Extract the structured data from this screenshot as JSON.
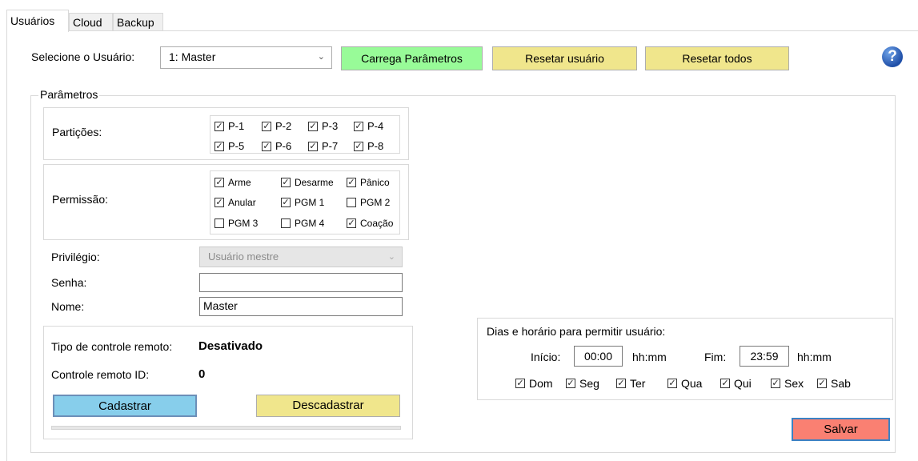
{
  "tabs": [
    "Usuários",
    "Cloud",
    "Backup"
  ],
  "header": {
    "select_user_label": "Selecione o Usuário:",
    "selected_user": "1: Master",
    "load_params_button": "Carrega Parâmetros",
    "reset_user_button": "Resetar usuário",
    "reset_all_button": "Resetar todos",
    "help_icon": "?"
  },
  "params": {
    "group_title": "Parâmetros",
    "partitions_label": "Partições:",
    "partitions": [
      {
        "label": "P-1",
        "checked": true
      },
      {
        "label": "P-2",
        "checked": true
      },
      {
        "label": "P-3",
        "checked": true
      },
      {
        "label": "P-4",
        "checked": true
      },
      {
        "label": "P-5",
        "checked": true
      },
      {
        "label": "P-6",
        "checked": true
      },
      {
        "label": "P-7",
        "checked": true
      },
      {
        "label": "P-8",
        "checked": true
      }
    ],
    "permission_label": "Permissão:",
    "permissions": [
      {
        "label": "Arme",
        "checked": true
      },
      {
        "label": "Desarme",
        "checked": true
      },
      {
        "label": "Pânico",
        "checked": true
      },
      {
        "label": "Anular",
        "checked": true
      },
      {
        "label": "PGM 1",
        "checked": true
      },
      {
        "label": "PGM 2",
        "checked": false
      },
      {
        "label": "PGM 3",
        "checked": false
      },
      {
        "label": "PGM 4",
        "checked": false
      },
      {
        "label": "Coação",
        "checked": true
      }
    ],
    "privilege_label": "Privilégio:",
    "privilege_value": "Usuário mestre",
    "password_label": "Senha:",
    "password_value": "",
    "name_label": "Nome:",
    "name_value": "Master"
  },
  "remote": {
    "type_label": "Tipo de controle remoto:",
    "type_value": "Desativado",
    "id_label": "Controle remoto ID:",
    "id_value": "0",
    "register_button": "Cadastrar",
    "unregister_button": "Descadastrar"
  },
  "schedule": {
    "title": "Dias e horário para permitir usuário:",
    "start_label": "Início:",
    "start_value": "00:00",
    "start_unit": "hh:mm",
    "end_label": "Fim:",
    "end_value": "23:59",
    "end_unit": "hh:mm",
    "days": [
      {
        "label": "Dom",
        "checked": true
      },
      {
        "label": "Seg",
        "checked": true
      },
      {
        "label": "Ter",
        "checked": true
      },
      {
        "label": "Qua",
        "checked": true
      },
      {
        "label": "Qui",
        "checked": true
      },
      {
        "label": "Sex",
        "checked": true
      },
      {
        "label": "Sab",
        "checked": true
      }
    ]
  },
  "save_button": "Salvar",
  "colors": {
    "load_green": "#98fb98",
    "reset_khaki": "#f0e68c",
    "register_blue": "#87ceeb",
    "save_salmon": "#fa8072"
  }
}
